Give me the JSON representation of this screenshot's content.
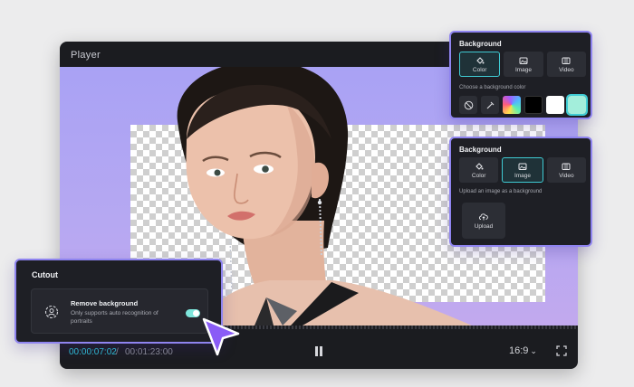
{
  "player": {
    "title": "Player",
    "time_current": "00:00:07:02",
    "time_separator": "/",
    "time_total": "00:01:23:00",
    "aspect_ratio": "16:9",
    "colors": {
      "accent": "#2fc5d9",
      "stage_bg": "#a9a2f4",
      "window_bg": "#1b1c20"
    }
  },
  "background_color_panel": {
    "title": "Background",
    "tabs": [
      {
        "label": "Color",
        "icon": "paint-bucket-icon",
        "active": true
      },
      {
        "label": "Image",
        "icon": "image-icon",
        "active": false
      },
      {
        "label": "Video",
        "icon": "film-icon",
        "active": false
      }
    ],
    "hint": "Choose a background color",
    "swatches": [
      {
        "name": "none",
        "icon": "no-color-icon"
      },
      {
        "name": "eyedropper",
        "icon": "eyedropper-icon"
      },
      {
        "name": "gradient",
        "color": "#ff5d7a"
      },
      {
        "name": "black",
        "color": "#000000"
      },
      {
        "name": "white",
        "color": "#ffffff"
      },
      {
        "name": "mint",
        "color": "#a3eedb",
        "selected": true
      }
    ]
  },
  "background_image_panel": {
    "title": "Background",
    "tabs": [
      {
        "label": "Color",
        "icon": "paint-bucket-icon",
        "active": false
      },
      {
        "label": "Image",
        "icon": "image-icon",
        "active": true
      },
      {
        "label": "Video",
        "icon": "film-icon",
        "active": false
      }
    ],
    "hint": "Upload an image as a background",
    "upload_label": "Upload"
  },
  "cutout_panel": {
    "title": "Cutout",
    "option_label": "Remove background",
    "option_desc": "Only supports auto recognition of portraits",
    "toggle_on": true
  }
}
